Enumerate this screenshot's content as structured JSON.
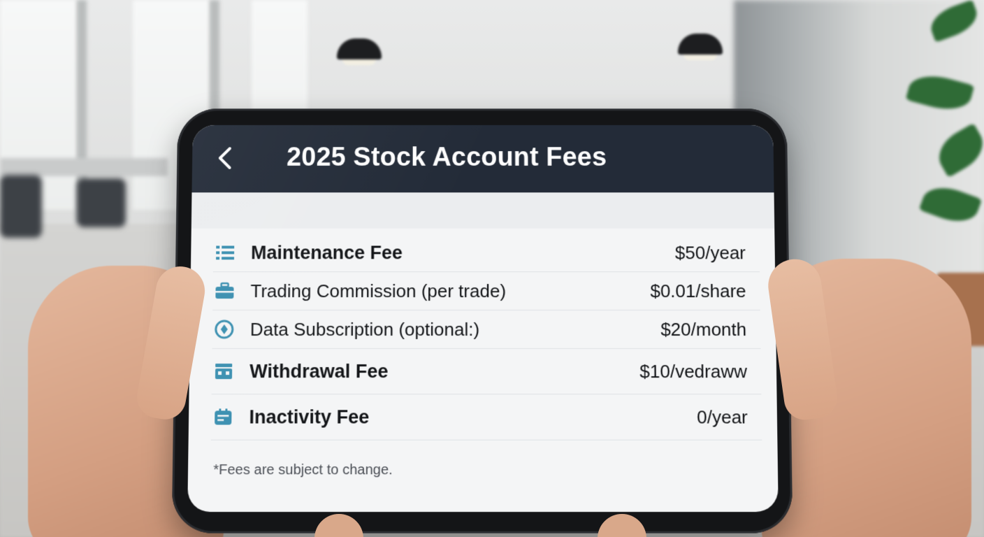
{
  "header": {
    "title": "2025 Stock Account Fees",
    "back_icon": "chevron-left-icon"
  },
  "fees": [
    {
      "icon": "list-icon",
      "label": "Maintenance Fee",
      "value": "$50/year"
    },
    {
      "icon": "briefcase-icon",
      "label": "Trading Commission (per trade)",
      "value": "$0.01/share"
    },
    {
      "icon": "data-circle-icon",
      "label": "Data Subscription (optional:)",
      "value": "$20/month"
    },
    {
      "icon": "bank-icon",
      "label": "Withdrawal Fee",
      "value": "$10/vedraww"
    },
    {
      "icon": "calendar-icon",
      "label": "Inactivity Fee",
      "value": "0/year"
    }
  ],
  "footnote": "*Fees are subject to change.",
  "colors": {
    "header_bg": "#232b38",
    "icon_accent": "#3a8fb0",
    "screen_bg": "#f4f5f6"
  }
}
